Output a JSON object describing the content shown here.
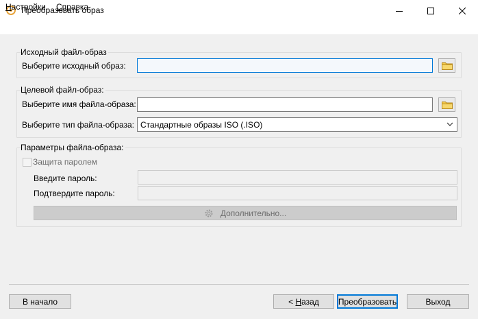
{
  "window": {
    "title": "Преобразовать образ",
    "icon": "disc-icon",
    "controls": {
      "minimize": "minimize-icon",
      "maximize": "maximize-icon",
      "close": "close-icon"
    }
  },
  "menu": [
    {
      "label": "Настройки",
      "accel": "Н",
      "rest": "астройки"
    },
    {
      "label": "Справка",
      "accel": "С",
      "rest": "правка"
    }
  ],
  "source_group": {
    "legend": "Исходный файл-образ",
    "label": "Выберите исходный образ:",
    "value": ""
  },
  "target_group": {
    "legend": "Целевой файл-образ:",
    "name_label": "Выберите имя файла-образа:",
    "name_value": "",
    "type_label": "Выберите тип файла-образа:",
    "type_value": "Стандартные образы ISO (.ISO)"
  },
  "params_group": {
    "legend": "Параметры файла-образа:",
    "password_protect": {
      "label": "Защита паролем",
      "checked": false
    },
    "password_label": "Введите пароль:",
    "confirm_label": "Подтвердите пароль:",
    "advanced_button": "Дополнительно..."
  },
  "footer": {
    "home_button": "В начало",
    "back_button": {
      "label": "< Назад",
      "prefix": "< ",
      "accel": "Н",
      "rest": "азад"
    },
    "convert_button": "Преобразовать",
    "exit_button": "Выход"
  },
  "colors": {
    "accent": "#0078d7",
    "icon_orange": "#e8a33a",
    "folder_yellow": "#f2c94c"
  }
}
